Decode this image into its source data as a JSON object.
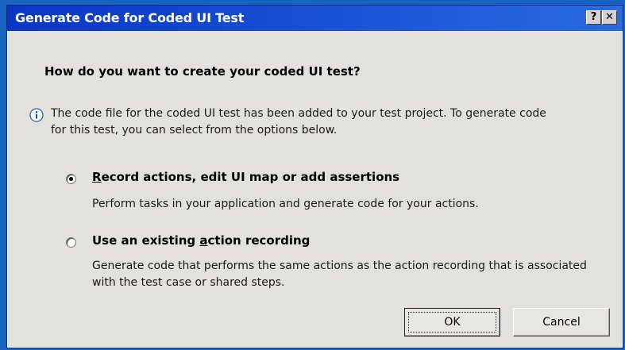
{
  "dialog": {
    "title": "Generate Code for Coded UI Test",
    "help_label": "?",
    "close_label": "✕"
  },
  "question": "How do you want to create your coded UI test?",
  "info_text": "The code file for the coded UI test has been added to your test project. To generate code for this test, you can select from the options below.",
  "options": [
    {
      "label": "Record actions, edit UI map or add assertions",
      "mnemonic": "R",
      "rest": "ecord actions, edit UI map or add assertions",
      "description": "Perform tasks in your application and generate code for your actions.",
      "selected": true
    },
    {
      "label": "Use an existing action recording",
      "prefix": "Use an existing ",
      "mnemonic": "a",
      "rest": "ction recording",
      "description": "Generate code that performs the same actions as the action recording that is associated with the test case or shared steps.",
      "selected": false
    }
  ],
  "buttons": {
    "ok_label": "OK",
    "cancel_label": "Cancel"
  },
  "icons": {
    "info": "info-icon",
    "help": "help-icon",
    "close": "close-icon"
  },
  "colors": {
    "titlebar": "#0a36c4",
    "dialog_bg": "#e3e1dc",
    "desktop": "#1565c0"
  }
}
